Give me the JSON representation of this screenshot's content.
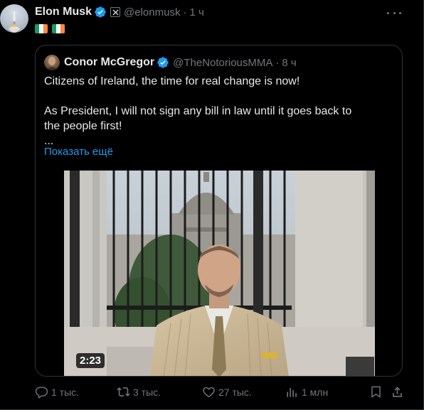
{
  "post": {
    "author_name": "Elon Musk",
    "handle": "@elonmusk",
    "separator": "·",
    "time": "1 ч",
    "flags": [
      {
        "name": "ireland",
        "colors": [
          "#169b62",
          "#ffffff",
          "#ff883e"
        ]
      },
      {
        "name": "ireland",
        "colors": [
          "#169b62",
          "#ffffff",
          "#ff883e"
        ]
      }
    ]
  },
  "quote": {
    "author_name": "Conor McGregor",
    "handle": "@TheNotoriousMMA",
    "separator": "·",
    "time": "8 ч",
    "text_line1": "Citizens of Ireland, the time for real change is now!",
    "text_line2": "As President, I will not sign any bill in law until it goes back to",
    "text_line3": "the people first!",
    "text_line4": "...",
    "show_more": "Показать ещё",
    "video": {
      "duration": "2:23"
    }
  },
  "actions": {
    "replies": "1 тыс.",
    "reposts": "3 тыс.",
    "likes": "27 тыс.",
    "views": "1 млн"
  },
  "colors": {
    "background": "#000000",
    "text": "#e7e9ea",
    "muted": "#71767b",
    "link": "#1d9bf0",
    "verified": "#1d9bf0",
    "border": "#2f3336"
  }
}
